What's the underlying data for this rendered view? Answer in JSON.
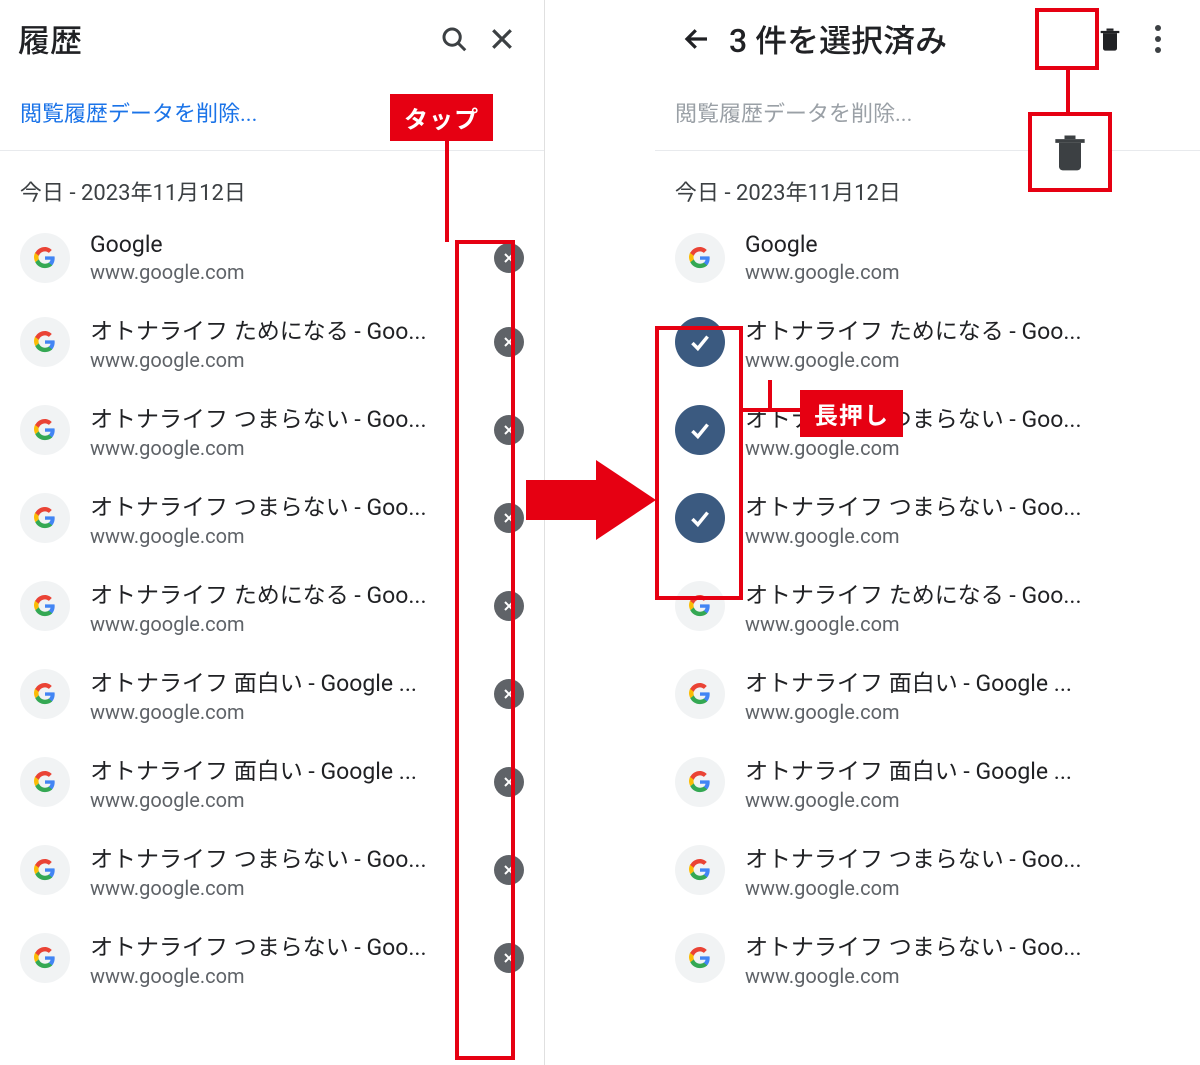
{
  "left": {
    "title": "履歴",
    "clear_link": "閲覧履歴データを削除...",
    "date": "今日 - 2023年11月12日",
    "items": [
      {
        "title": "Google",
        "url": "www.google.com"
      },
      {
        "title": "オトナライフ ためになる - Goo...",
        "url": "www.google.com"
      },
      {
        "title": "オトナライフ つまらない - Goo...",
        "url": "www.google.com"
      },
      {
        "title": "オトナライフ つまらない - Goo...",
        "url": "www.google.com"
      },
      {
        "title": "オトナライフ ためになる - Goo...",
        "url": "www.google.com"
      },
      {
        "title": "オトナライフ 面白い - Google ...",
        "url": "www.google.com"
      },
      {
        "title": "オトナライフ 面白い - Google ...",
        "url": "www.google.com"
      },
      {
        "title": "オトナライフ つまらない - Goo...",
        "url": "www.google.com"
      },
      {
        "title": "オトナライフ つまらない - Goo...",
        "url": "www.google.com"
      }
    ],
    "callout_tap": "タップ"
  },
  "right": {
    "title": "3 件を選択済み",
    "clear_link": "閲覧履歴データを削除...",
    "date": "今日 - 2023年11月12日",
    "items": [
      {
        "title": "Google",
        "url": "www.google.com",
        "selected": false
      },
      {
        "title": "オトナライフ ためになる - Goo...",
        "url": "www.google.com",
        "selected": true
      },
      {
        "title": "オトナライフ つまらない - Goo...",
        "url": "www.google.com",
        "selected": true
      },
      {
        "title": "オトナライフ つまらない - Goo...",
        "url": "www.google.com",
        "selected": true
      },
      {
        "title": "オトナライフ ためになる - Goo...",
        "url": "www.google.com",
        "selected": false
      },
      {
        "title": "オトナライフ 面白い - Google ...",
        "url": "www.google.com",
        "selected": false
      },
      {
        "title": "オトナライフ 面白い - Google ...",
        "url": "www.google.com",
        "selected": false
      },
      {
        "title": "オトナライフ つまらない - Goo...",
        "url": "www.google.com",
        "selected": false
      },
      {
        "title": "オトナライフ つまらない - Goo...",
        "url": "www.google.com",
        "selected": false
      }
    ],
    "callout_longpress": "長押し"
  }
}
